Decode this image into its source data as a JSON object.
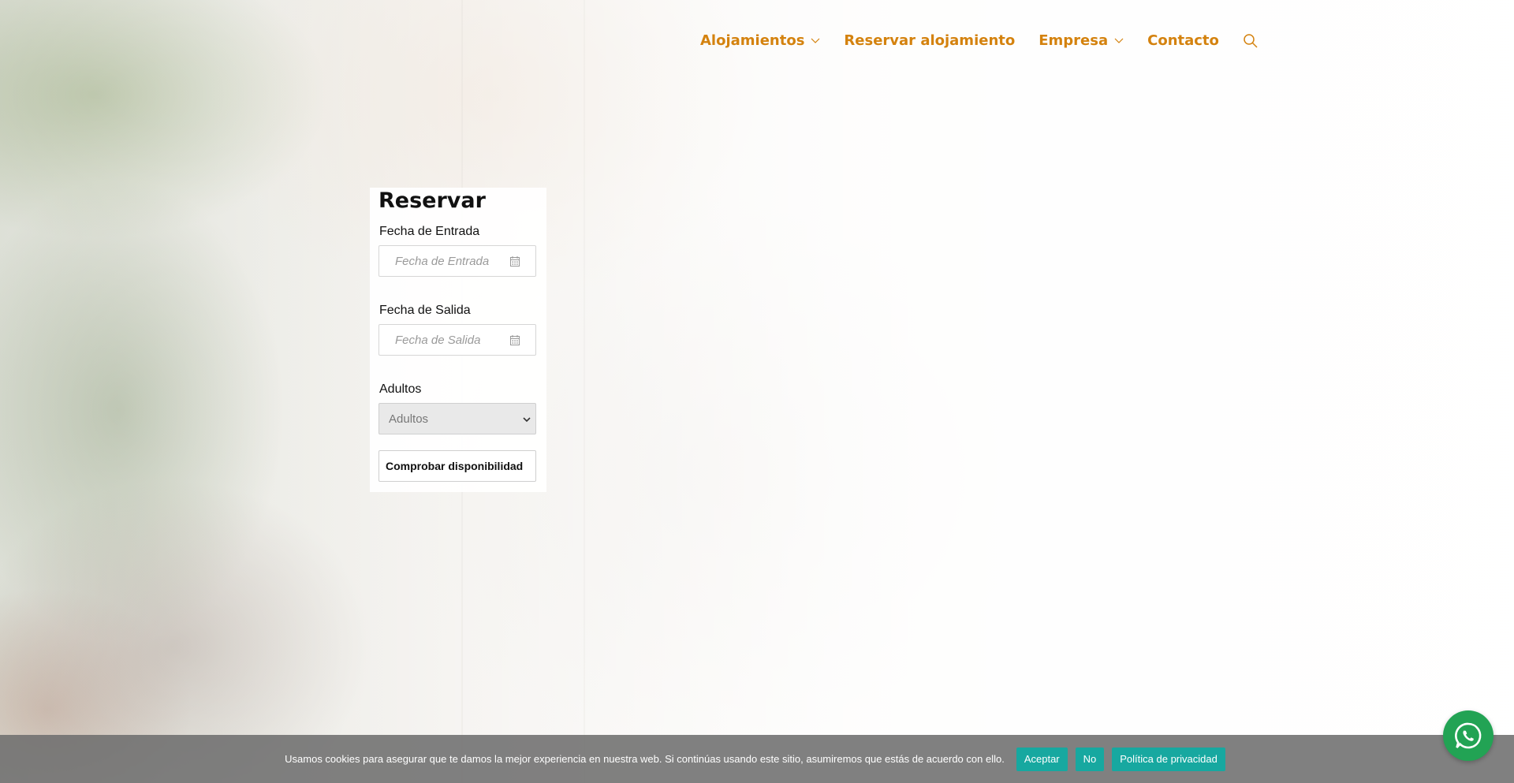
{
  "nav": {
    "items": [
      {
        "label": "Alojamientos",
        "has_dropdown": true
      },
      {
        "label": "Reservar alojamiento",
        "has_dropdown": false
      },
      {
        "label": "Empresa",
        "has_dropdown": true
      },
      {
        "label": "Contacto",
        "has_dropdown": false
      }
    ],
    "search_icon": "search-icon",
    "color": "#d4820e"
  },
  "booking": {
    "title": "Reservar",
    "checkin": {
      "label": "Fecha de Entrada",
      "placeholder": "Fecha de Entrada",
      "value": ""
    },
    "checkout": {
      "label": "Fecha de Salida",
      "placeholder": "Fecha de Salida",
      "value": ""
    },
    "adults": {
      "label": "Adultos",
      "selected": "Adultos"
    },
    "submit_label": "Comprobar disponibilidad"
  },
  "cookie_bar": {
    "text": "Usamos cookies para asegurar que te damos la mejor experiencia en nuestra web. Si continúas usando este sitio, asumiremos que estás de acuerdo con ello.",
    "accept_label": "Aceptar",
    "reject_label": "No",
    "privacy_label": "Política de privacidad",
    "button_color": "#17a8a0"
  },
  "whatsapp": {
    "icon": "whatsapp-icon",
    "color": "#22a354"
  }
}
